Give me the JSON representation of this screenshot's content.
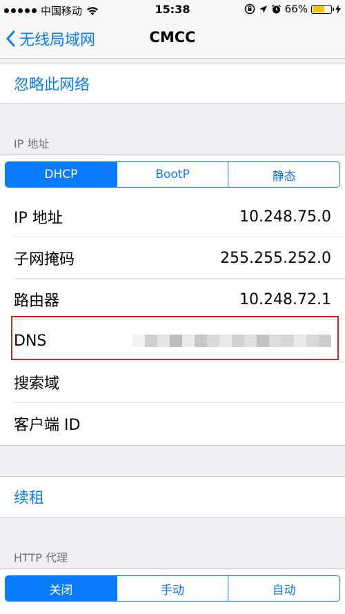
{
  "status_bar": {
    "carrier": "中国移动",
    "time": "15:38",
    "battery_percent": "66%",
    "battery_level": 0.66,
    "signal_dots": 5,
    "signal_filled": 5
  },
  "nav": {
    "back_label": "无线局域网",
    "title": "CMCC"
  },
  "forget_label": "忽略此网络",
  "ip_section": {
    "header": "IP 地址",
    "segments": [
      "DHCP",
      "BootP",
      "静态"
    ],
    "selected": 0
  },
  "rows": [
    {
      "label": "IP 地址",
      "value": "10.248.75.0"
    },
    {
      "label": "子网掩码",
      "value": "255.255.252.0"
    },
    {
      "label": "路由器",
      "value": "10.248.72.1"
    },
    {
      "label": "DNS",
      "value": ""
    },
    {
      "label": "搜索域",
      "value": ""
    },
    {
      "label": "客户端 ID",
      "value": ""
    }
  ],
  "renew_label": "续租",
  "proxy_section": {
    "header": "HTTP 代理",
    "segments": [
      "关闭",
      "手动",
      "自动"
    ],
    "selected": 0
  },
  "colors": {
    "accent": "#0a7aff",
    "highlight_border": "#e02020",
    "background": "#efeff4",
    "battery": "#f5c400"
  }
}
